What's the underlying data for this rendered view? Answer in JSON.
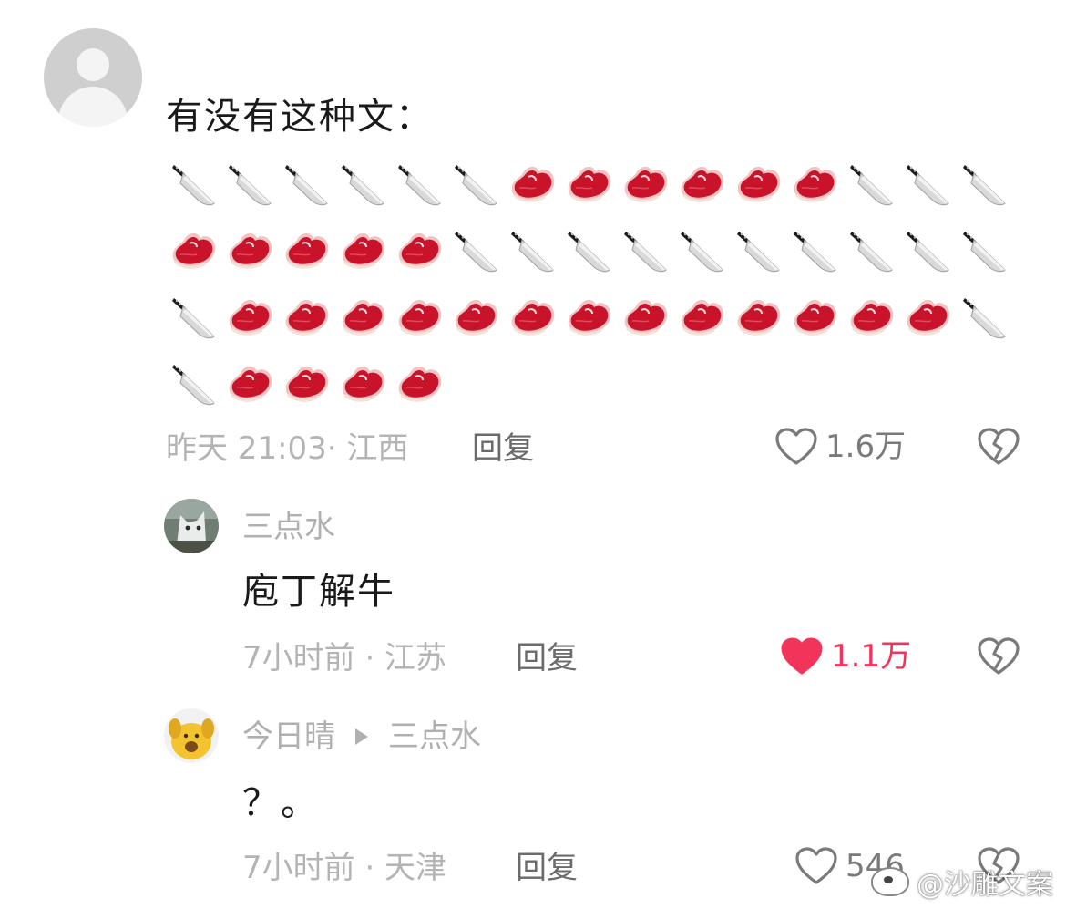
{
  "comment": {
    "text": "有没有这种文：",
    "emoji_rows": [
      [
        "knife",
        "knife",
        "knife",
        "knife",
        "knife",
        "knife",
        "meat",
        "meat",
        "meat",
        "meat",
        "meat",
        "meat",
        "knife",
        "knife",
        "knife"
      ],
      [
        "meat",
        "meat",
        "meat",
        "meat",
        "meat",
        "knife",
        "knife",
        "knife",
        "knife",
        "knife",
        "knife",
        "knife",
        "knife",
        "knife",
        "knife"
      ],
      [
        "knife",
        "meat",
        "meat",
        "meat",
        "meat",
        "meat",
        "meat",
        "meat",
        "meat",
        "meat",
        "meat",
        "meat",
        "meat",
        "meat",
        "knife"
      ],
      [
        "knife",
        "meat",
        "meat",
        "meat",
        "meat"
      ]
    ],
    "meta": "昨天 21:03· 江西",
    "reply_label": "回复",
    "like_count": "1.6万",
    "liked": false
  },
  "replies": [
    {
      "name": "三点水",
      "reply_to": "",
      "text": "庖丁解牛",
      "meta": "7小时前 · 江苏",
      "reply_label": "回复",
      "like_count": "1.1万",
      "liked": true,
      "avatar_icon": "cat-avatar-icon"
    },
    {
      "name": "今日晴",
      "reply_to": "三点水",
      "text": "？。",
      "meta": "7小时前 · 天津",
      "reply_label": "回复",
      "like_count": "546",
      "liked": false,
      "avatar_icon": "dog-avatar-icon"
    }
  ],
  "watermark": "@沙雕文案",
  "colors": {
    "liked_red": "#f2345a",
    "meta_gray": "#b4b4b4",
    "icon_gray": "#7a7a7a"
  }
}
